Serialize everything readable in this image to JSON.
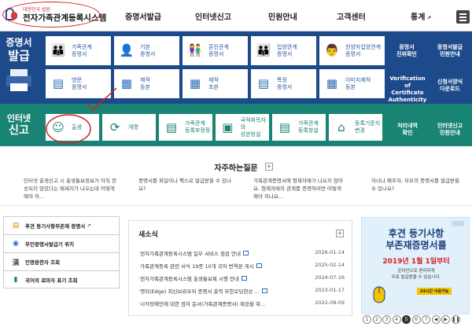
{
  "header": {
    "logo_sub": "대한민국 법원",
    "logo_main": "전자가족관계등록시스템",
    "nav": [
      "증명서발급",
      "인터넷신고",
      "민원안내",
      "고객센터",
      "통계"
    ]
  },
  "certificate": {
    "label_line1": "증명서",
    "label_line2": "발급",
    "cards": [
      {
        "l1": "가족관계",
        "l2": "증명서",
        "icon": "family-icon"
      },
      {
        "l1": "기본",
        "l2": "증명서",
        "icon": "person-icon"
      },
      {
        "l1": "혼인관계",
        "l2": "증명서",
        "icon": "couple-icon"
      },
      {
        "l1": "입양관계",
        "l2": "증명서",
        "icon": "adoption-icon"
      },
      {
        "l1": "친양자입양관계",
        "l2": "증명서",
        "icon": "family-group-icon"
      },
      {
        "l1": "영문",
        "l2": "증명서",
        "icon": "english-doc-icon"
      },
      {
        "l1": "제적",
        "l2": "등본",
        "icon": "register-icon"
      },
      {
        "l1": "제적",
        "l2": "초본",
        "icon": "register-icon"
      },
      {
        "l1": "특정",
        "l2": "증명서",
        "icon": "document-icon"
      },
      {
        "l1": "이미지제적",
        "l2": "등본",
        "icon": "image-register-icon"
      }
    ],
    "side": [
      {
        "l1": "증명서",
        "l2": "진위확인"
      },
      {
        "l1": "증명서발급",
        "l2": "민원안내"
      },
      {
        "l1": "Verification of",
        "l2": "Certificate",
        "l3": "Authenticity"
      },
      {
        "l1": "신청서양식",
        "l2": "다운로드"
      }
    ]
  },
  "report": {
    "label_line1": "인터넷",
    "label_line2": "신고",
    "cards": [
      {
        "l1": "출생",
        "l2": "",
        "icon": "baby-icon"
      },
      {
        "l1": "개명",
        "l2": "",
        "icon": "rename-icon"
      },
      {
        "l1": "가족관계",
        "l2": "등록부정정",
        "icon": "document-icon"
      },
      {
        "l1": "국적취득자의",
        "l2": "성본창설",
        "icon": "person-doc-icon"
      },
      {
        "l1": "가족관계",
        "l2": "등록창설",
        "icon": "document-icon"
      },
      {
        "l1": "등록기준지",
        "l2": "변경",
        "icon": "house-icon"
      }
    ],
    "side": [
      {
        "l1": "처리내역",
        "l2": "확인"
      },
      {
        "l1": "인터넷신고",
        "l2": "민원안내"
      }
    ]
  },
  "faq": {
    "title": "자주하는질문",
    "items": [
      "인터넷 출생신고 시 출생통보정보가 아직 전송되지 않았다는 메세지가 나오는데 어떻게 해야 하...",
      "증명서를 파일이나 팩스로 발급받을 수 있나요?",
      "가족관계증명서에 형제자매가 나오지 않아요. 형제자매의 관계를 증명하려면 어떻게 해야 하나요...",
      "자녀나 배우자, 부모의 증명서를 발급받을 수 있나요?"
    ]
  },
  "quick_links": [
    {
      "label": "후견 등기사항부존재 증명서",
      "icon": "certificate-icon"
    },
    {
      "label": "무인증명서발급기 위치",
      "icon": "location-icon"
    },
    {
      "label": "인명용한자 조회",
      "icon": "hanja-icon"
    },
    {
      "label": "국어의 로마자 표기 조회",
      "icon": "book-icon"
    }
  ],
  "news": {
    "title": "새소식",
    "items": [
      {
        "title": "전자가족관계등록시스템 일부 서비스 점검 안내",
        "date": "2026-01-14",
        "new": true
      },
      {
        "title": "가족관계등록 관련 서식 19종 10개 국어 번역본 게시",
        "date": "2025-02-14",
        "new": true
      },
      {
        "title": "전자가족관계등록시스템 출생통보제 시행 안내",
        "date": "2024-07-16",
        "new": true
      },
      {
        "title": "엣지(Edge) 최신브라우저 증명서 출력 무한로딩현상 ...",
        "date": "2023-01-17",
        "new": true
      },
      {
        "title": "시각장애인에 대한 점자 문서(가족관계증명서) 제공을 위...",
        "date": "2022-08-09",
        "new": false
      }
    ]
  },
  "banner": {
    "line1": "후견 등기사항",
    "line2": "부존재증명서를",
    "line3": "2019년 1월 1일부터",
    "line4": "온라인으로 편리하게",
    "line5": "무료 발급받을 수 있습니다.",
    "line6": "24시간 이용가능"
  },
  "pager": [
    "1",
    "2",
    "3",
    "4",
    "5",
    "6",
    "7"
  ],
  "pager_active": "5",
  "colors": {
    "blue": "#1d4a8a",
    "green": "#1a8474",
    "annotation": "#d42020"
  }
}
